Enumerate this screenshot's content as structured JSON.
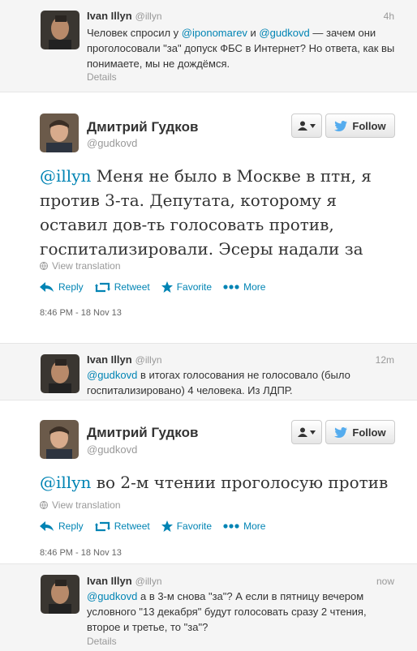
{
  "tweets": [
    {
      "name": "Ivan Illyn",
      "handle": "@illyn",
      "time": "4h",
      "text_parts": [
        "Человек спросил у ",
        "@iponomarev",
        " и ",
        "@gudkovd",
        " — зачем они проголосовали \"за\" допуск ФБС в Интернет? Но ответа, как вы понимаете, мы не дождёмся."
      ],
      "details": "Details"
    },
    {
      "name": "Дмитрий Гудков",
      "handle": "@gudkovd",
      "mention": "@illyn",
      "text": " Меня не было в Москве в птн, я против 3-та. Депутата, которому я оставил дов-ть голосовать против, госпитализировали. Эсеры надали за",
      "translate": "View translation",
      "timestamp": "8:46 PM - 18 Nov 13"
    },
    {
      "name": "Ivan Illyn",
      "handle": "@illyn",
      "time": "12m",
      "mention": "@gudkovd",
      "text": " в итогах голосования не голосовало (было госпитализировано) 4 человека. Из ЛДПР."
    },
    {
      "name": "Дмитрий Гудков",
      "handle": "@gudkovd",
      "mention": "@illyn",
      "text": " во 2-м чтении проголосую против",
      "translate": "View translation",
      "timestamp": "8:46 PM - 18 Nov 13"
    },
    {
      "name": "Ivan Illyn",
      "handle": "@illyn",
      "time": "now",
      "mention": "@gudkovd",
      "text": " а в 3-м снова \"за\"? А если в пятницу вечером условного \"13 декабря\" будут голосовать сразу 2 чтения, второе и третье, то \"за\"?",
      "details": "Details"
    }
  ],
  "actions": {
    "reply": "Reply",
    "retweet": "Retweet",
    "favorite": "Favorite",
    "more": "More"
  },
  "follow_label": "Follow",
  "colors": {
    "link": "#0084b4",
    "follow_bird": "#55acee"
  }
}
